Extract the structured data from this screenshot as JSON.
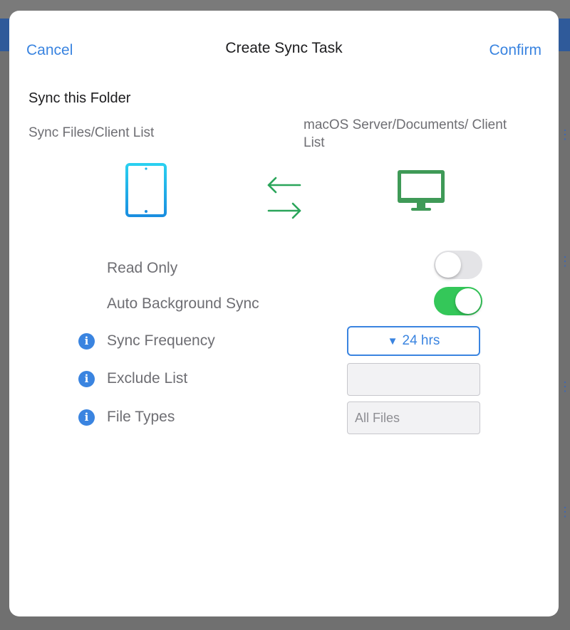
{
  "header": {
    "cancel_label": "Cancel",
    "title": "Create Sync Task",
    "confirm_label": "Confirm"
  },
  "section": {
    "title": "Sync this Folder",
    "local_path": "Sync Files/Client List",
    "remote_path": "macOS Server/Documents/ Client List"
  },
  "icons": {
    "local_device": "tablet-icon",
    "sync_direction": "two-way-arrows-icon",
    "remote_device": "monitor-icon"
  },
  "settings": {
    "read_only": {
      "label": "Read Only",
      "enabled": false
    },
    "auto_background_sync": {
      "label": "Auto Background Sync",
      "enabled": true
    },
    "sync_frequency": {
      "label": "Sync Frequency",
      "value": "24 hrs"
    },
    "exclude_list": {
      "label": "Exclude List",
      "value": ""
    },
    "file_types": {
      "label": "File Types",
      "placeholder": "All Files"
    }
  },
  "colors": {
    "accent": "#3a84e0",
    "toggle_on": "#34c759",
    "tablet": "#1fb4e8",
    "monitor": "#3f9a57",
    "arrows": "#2aa55a"
  }
}
